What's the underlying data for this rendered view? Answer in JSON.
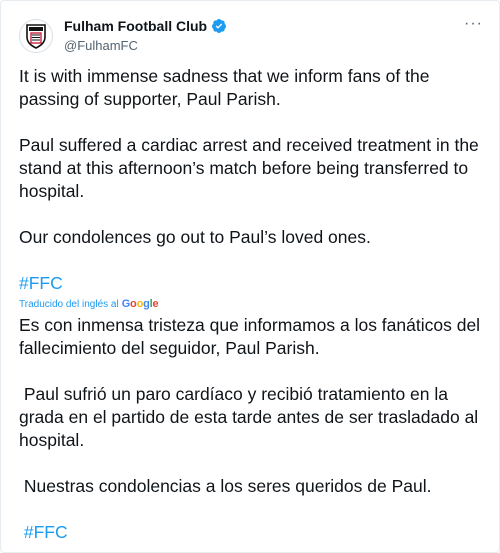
{
  "header": {
    "account_name": "Fulham Football Club",
    "handle": "@FulhamFC",
    "more_label": "···"
  },
  "tweet": {
    "p1": "It is with immense sadness that we inform fans of the passing of supporter, Paul Parish.",
    "p2": "Paul suffered a cardiac arrest and received treatment in the stand at this afternoon’s match before being transferred to hospital.",
    "p3": "Our condolences go out to Paul’s loved ones.",
    "hashtag": "#FFC"
  },
  "translation": {
    "attribution": "Traducido del inglés al",
    "provider": "Google",
    "p1": "Es con inmensa tristeza que informamos a los fanáticos del fallecimiento del seguidor, Paul Parish.",
    "p2": " Paul sufrió un paro cardíaco y recibió tratamiento en la grada en el partido de esta tarde antes de ser trasladado al hospital.",
    "p3": " Nuestras condolencias a los seres queridos de Paul.",
    "hashtag": " #FFC"
  },
  "colors": {
    "link": "#1d9bf0",
    "secondary_text": "#536471",
    "primary_text": "#0f1419"
  },
  "icons": {
    "avatar": "fulham-crest-icon",
    "verified": "verified-badge-icon",
    "more": "more-options-icon"
  }
}
